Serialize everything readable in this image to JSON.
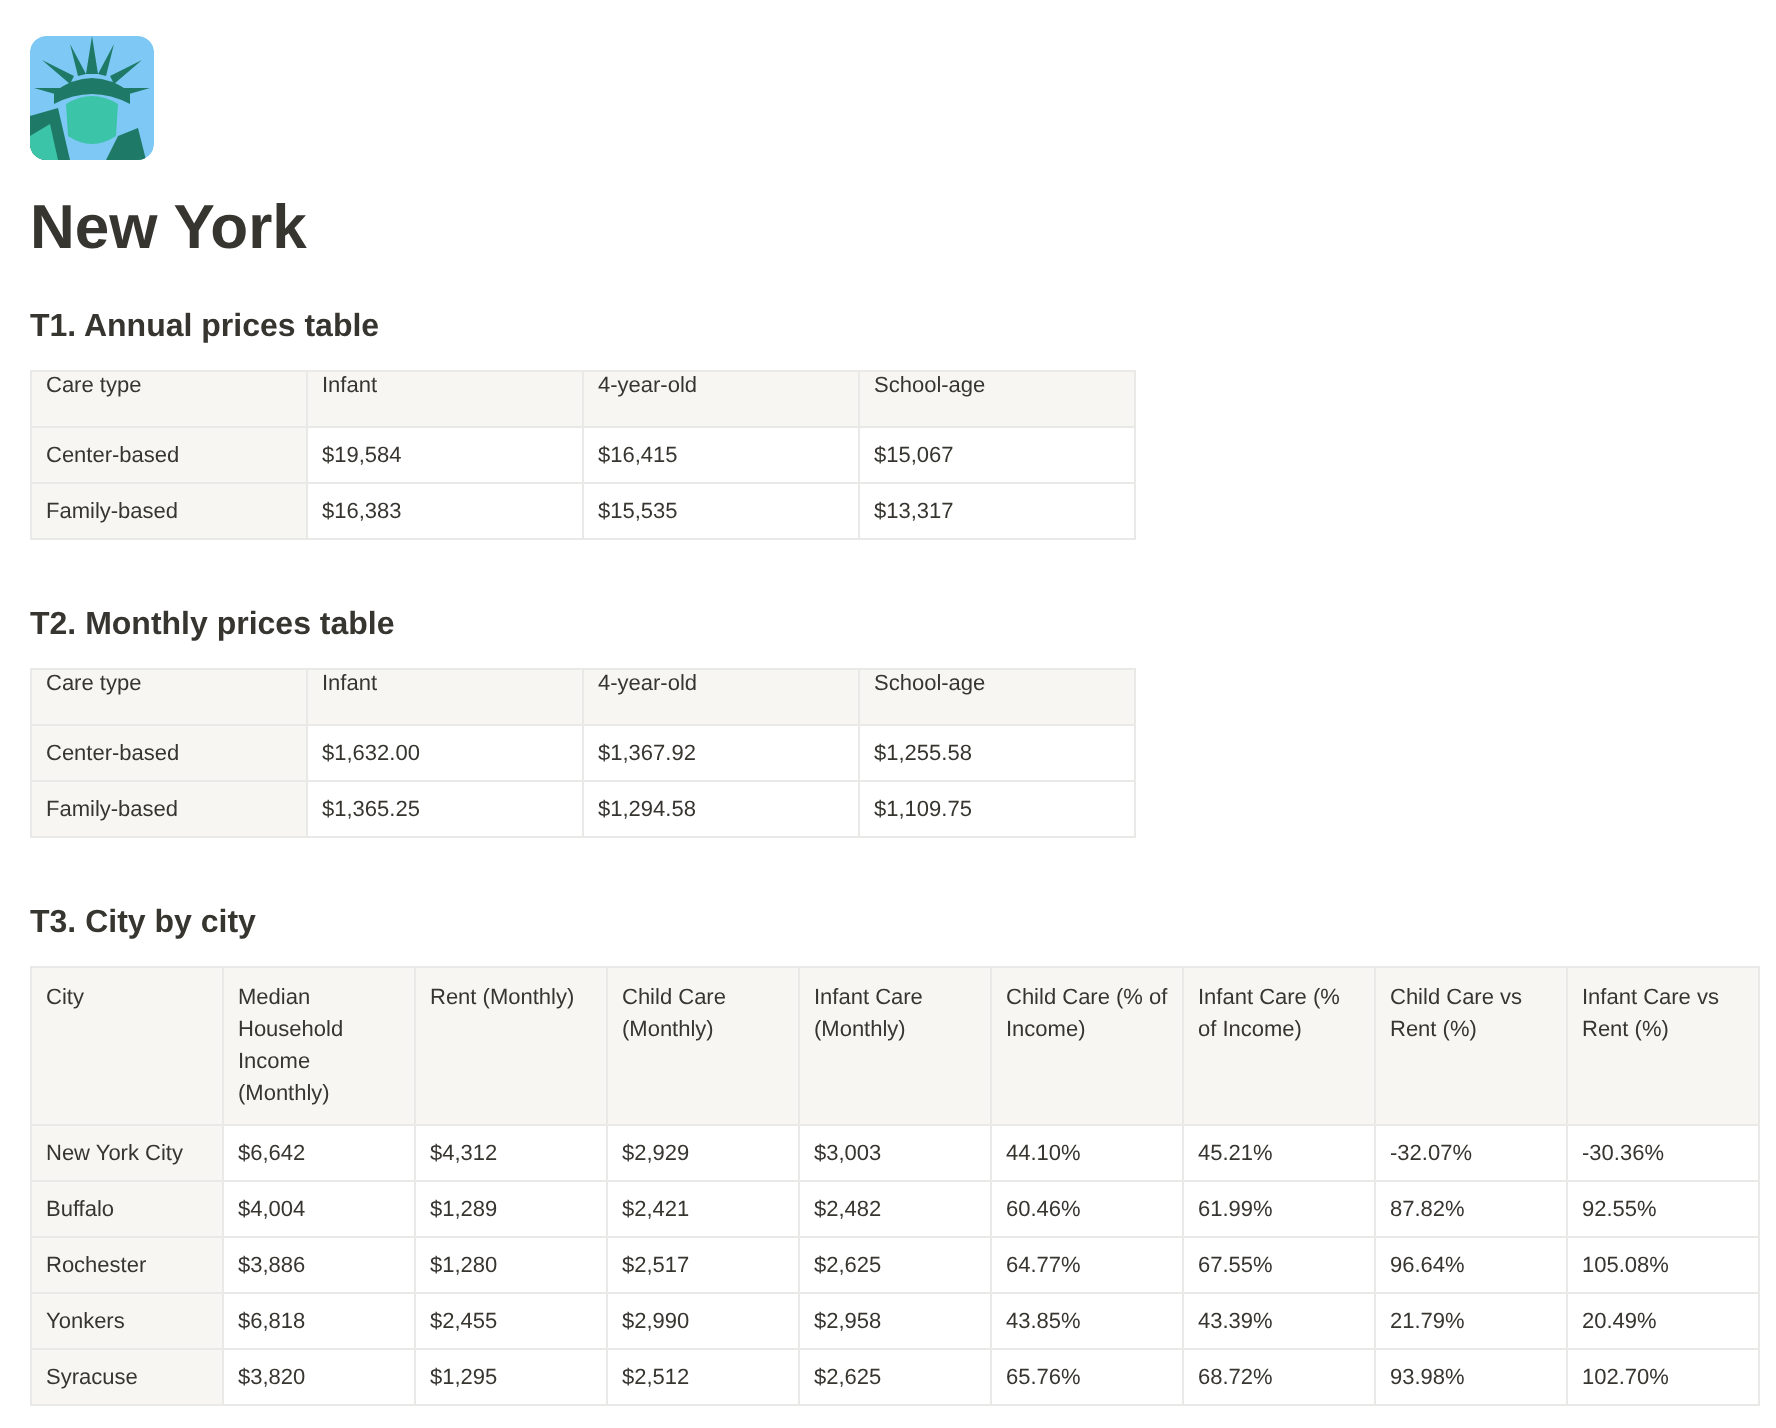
{
  "page": {
    "title": "New York"
  },
  "tables": [
    {
      "heading": "T1. Annual prices table",
      "columns": [
        "Care type",
        "Infant",
        "4-year-old",
        "School-age"
      ],
      "rows": [
        [
          "Center-based",
          "$19,584",
          "$16,415",
          "$15,067"
        ],
        [
          "Family-based",
          "$16,383",
          "$15,535",
          "$13,317"
        ]
      ]
    },
    {
      "heading": "T2. Monthly prices table",
      "columns": [
        "Care type",
        "Infant",
        "4-year-old",
        "School-age"
      ],
      "rows": [
        [
          "Center-based",
          "$1,632.00",
          "$1,367.92",
          "$1,255.58"
        ],
        [
          "Family-based",
          "$1,365.25",
          "$1,294.58",
          "$1,109.75"
        ]
      ]
    },
    {
      "heading": "T3. City by city",
      "columns": [
        "City",
        "Median Household Income (Monthly)",
        "Rent (Monthly)",
        "Child Care (Monthly)",
        "Infant Care (Monthly)",
        "Child Care (% of Income)",
        "Infant Care (% of Income)",
        "Child Care vs Rent (%)",
        "Infant Care vs Rent (%)"
      ],
      "rows": [
        [
          "New York City",
          "$6,642",
          "$4,312",
          "$2,929",
          "$3,003",
          "44.10%",
          "45.21%",
          "-32.07%",
          "-30.36%"
        ],
        [
          "Buffalo",
          "$4,004",
          "$1,289",
          "$2,421",
          "$2,482",
          "60.46%",
          "61.99%",
          "87.82%",
          "92.55%"
        ],
        [
          "Rochester",
          "$3,886",
          "$1,280",
          "$2,517",
          "$2,625",
          "64.77%",
          "67.55%",
          "96.64%",
          "105.08%"
        ],
        [
          "Yonkers",
          "$6,818",
          "$2,455",
          "$2,990",
          "$2,958",
          "43.85%",
          "43.39%",
          "21.79%",
          "20.49%"
        ],
        [
          "Syracuse",
          "$3,820",
          "$1,295",
          "$2,512",
          "$2,625",
          "65.76%",
          "68.72%",
          "93.98%",
          "102.70%"
        ]
      ]
    }
  ]
}
